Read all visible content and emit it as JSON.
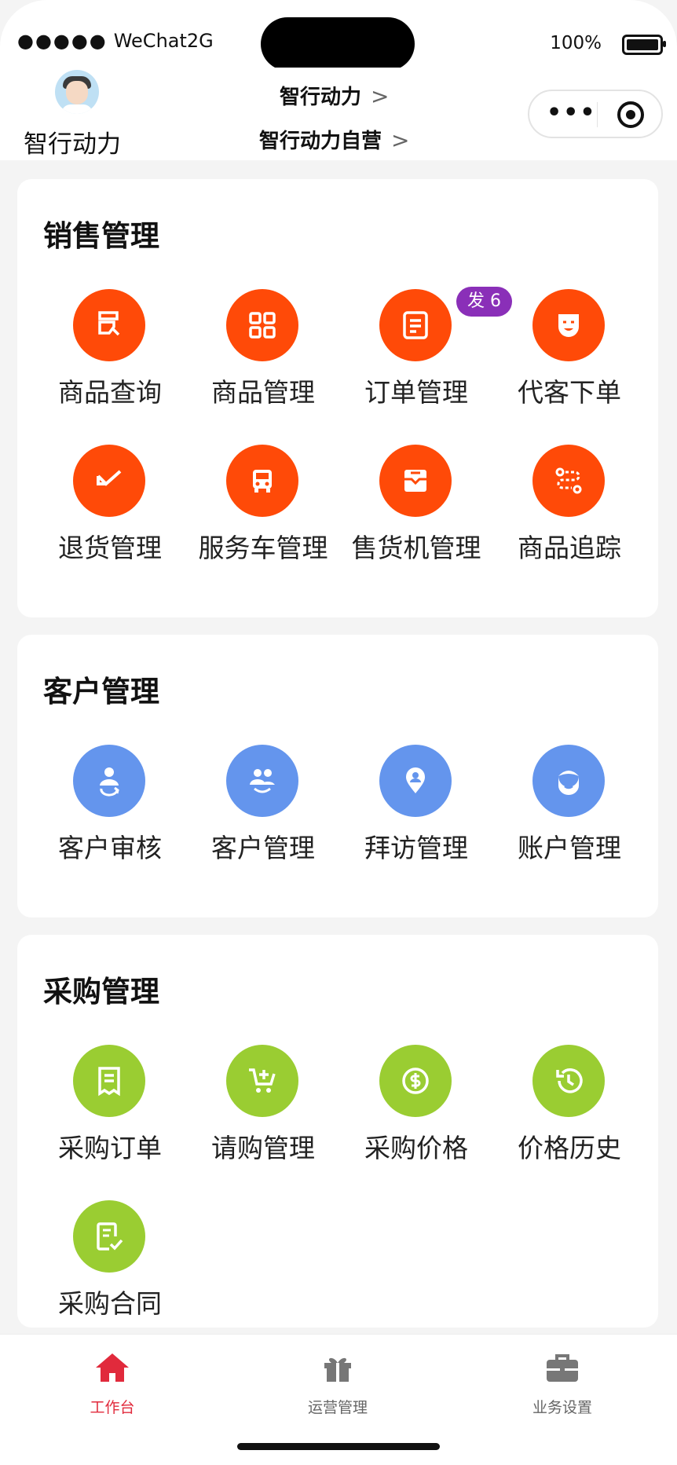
{
  "status_bar": {
    "carrier": "WeChat2G",
    "signal_dots": "●●●●●",
    "battery": "100%"
  },
  "header": {
    "company_name": "智行动力",
    "main_title": "智行动力",
    "sub_title": "智行动力自营",
    "chevron": ">",
    "more": "•••"
  },
  "colors": {
    "sales": "#ff4a08",
    "customer": "#6495ed",
    "purchase": "#9acd32",
    "badge": "#8a2fb8",
    "active_tab": "#e12a3c"
  },
  "sections": [
    {
      "title": "销售管理",
      "items": [
        {
          "label": "商品查询",
          "icon": "product-search-icon"
        },
        {
          "label": "商品管理",
          "icon": "grid-icon"
        },
        {
          "label": "订单管理",
          "icon": "order-icon",
          "badge": "发 6"
        },
        {
          "label": "代客下单",
          "icon": "mask-icon"
        },
        {
          "label": "退货管理",
          "icon": "return-icon"
        },
        {
          "label": "服务车管理",
          "icon": "vehicle-icon"
        },
        {
          "label": "售货机管理",
          "icon": "vending-icon"
        },
        {
          "label": "商品追踪",
          "icon": "tracking-icon"
        }
      ]
    },
    {
      "title": "客户管理",
      "items": [
        {
          "label": "客户审核",
          "icon": "user-check-icon"
        },
        {
          "label": "客户管理",
          "icon": "users-icon"
        },
        {
          "label": "拜访管理",
          "icon": "location-person-icon"
        },
        {
          "label": "账户管理",
          "icon": "account-face-icon"
        }
      ]
    },
    {
      "title": "采购管理",
      "items": [
        {
          "label": "采购订单",
          "icon": "receipt-icon"
        },
        {
          "label": "请购管理",
          "icon": "cart-add-icon"
        },
        {
          "label": "采购价格",
          "icon": "dollar-icon"
        },
        {
          "label": "价格历史",
          "icon": "history-icon"
        },
        {
          "label": "采购合同",
          "icon": "contract-icon"
        }
      ]
    }
  ],
  "tabs": [
    {
      "label": "工作台",
      "icon": "home-icon",
      "active": true
    },
    {
      "label": "运营管理",
      "icon": "gift-icon",
      "active": false
    },
    {
      "label": "业务设置",
      "icon": "briefcase-icon",
      "active": false
    }
  ]
}
